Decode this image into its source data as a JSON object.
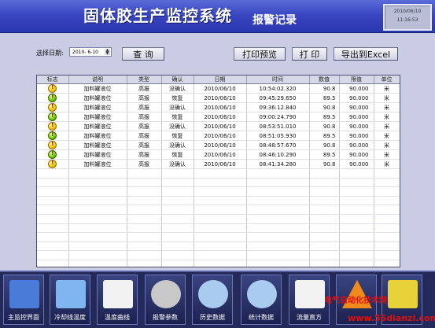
{
  "header": {
    "title": "固体胶生产监控系统",
    "subtitle": "报警记录",
    "clock_date": "2010/06/10",
    "clock_time": "11:16:53"
  },
  "toolbar": {
    "date_label": "选择日期:",
    "date_value": "2010- 6-10",
    "query": "查 询",
    "print_preview": "打印预览",
    "print": "打 印",
    "export": "导出到Excel"
  },
  "table": {
    "columns": [
      "标志",
      "说明",
      "类型",
      "确认",
      "日期",
      "时间",
      "数值",
      "限值",
      "单位"
    ],
    "rows": [
      {
        "flag": "yellow",
        "desc": "加料罐液位",
        "type": "高报",
        "confirm": "没确认",
        "date": "2010/06/10",
        "time": "10:54:02.320",
        "value": "90.8",
        "limit": "90.000",
        "unit": "米"
      },
      {
        "flag": "green",
        "desc": "加料罐液位",
        "type": "高报",
        "confirm": "恢复",
        "date": "2010/06/10",
        "time": "09:45:29.650",
        "value": "89.5",
        "limit": "90.000",
        "unit": "米"
      },
      {
        "flag": "yellow",
        "desc": "加料罐液位",
        "type": "高报",
        "confirm": "没确认",
        "date": "2010/06/10",
        "time": "09:36:12.840",
        "value": "90.8",
        "limit": "90.000",
        "unit": "米"
      },
      {
        "flag": "green",
        "desc": "加料罐液位",
        "type": "高报",
        "confirm": "恢复",
        "date": "2010/06/10",
        "time": "09:00:24.790",
        "value": "89.5",
        "limit": "90.000",
        "unit": "米"
      },
      {
        "flag": "yellow",
        "desc": "加料罐液位",
        "type": "高报",
        "confirm": "没确认",
        "date": "2010/06/10",
        "time": "08:53:51.010",
        "value": "90.8",
        "limit": "90.000",
        "unit": "米"
      },
      {
        "flag": "green",
        "desc": "加料罐液位",
        "type": "高报",
        "confirm": "恢复",
        "date": "2010/06/10",
        "time": "08:51:05.930",
        "value": "89.5",
        "limit": "90.000",
        "unit": "米"
      },
      {
        "flag": "yellow",
        "desc": "加料罐液位",
        "type": "高报",
        "confirm": "没确认",
        "date": "2010/06/10",
        "time": "08:48:57.670",
        "value": "90.8",
        "limit": "90.000",
        "unit": "米"
      },
      {
        "flag": "green",
        "desc": "加料罐液位",
        "type": "高报",
        "confirm": "恢复",
        "date": "2010/06/10",
        "time": "08:46:10.290",
        "value": "89.5",
        "limit": "90.000",
        "unit": "米"
      },
      {
        "flag": "yellow",
        "desc": "加料罐液位",
        "type": "高报",
        "confirm": "没确认",
        "date": "2010/06/10",
        "time": "08:41:34.280",
        "value": "90.8",
        "limit": "90.000",
        "unit": "米"
      }
    ]
  },
  "nav": {
    "items": [
      {
        "label": "主监控界面",
        "icon": "monitor-icon"
      },
      {
        "label": "冷却线温度",
        "icon": "screen-icon"
      },
      {
        "label": "温度曲线",
        "icon": "chart-icon"
      },
      {
        "label": "报警参数",
        "icon": "gear-icon"
      },
      {
        "label": "历史数据",
        "icon": "magnifier-icon"
      },
      {
        "label": "统计数据",
        "icon": "magnifier-chart-icon"
      },
      {
        "label": "流量直方",
        "icon": "bars-icon"
      },
      {
        "label": "",
        "icon": "warning-icon"
      },
      {
        "label": "",
        "icon": "exit-icon"
      }
    ]
  },
  "watermark": {
    "line1": "电气自动化技术网",
    "line2": "www.55dianzi.com"
  }
}
